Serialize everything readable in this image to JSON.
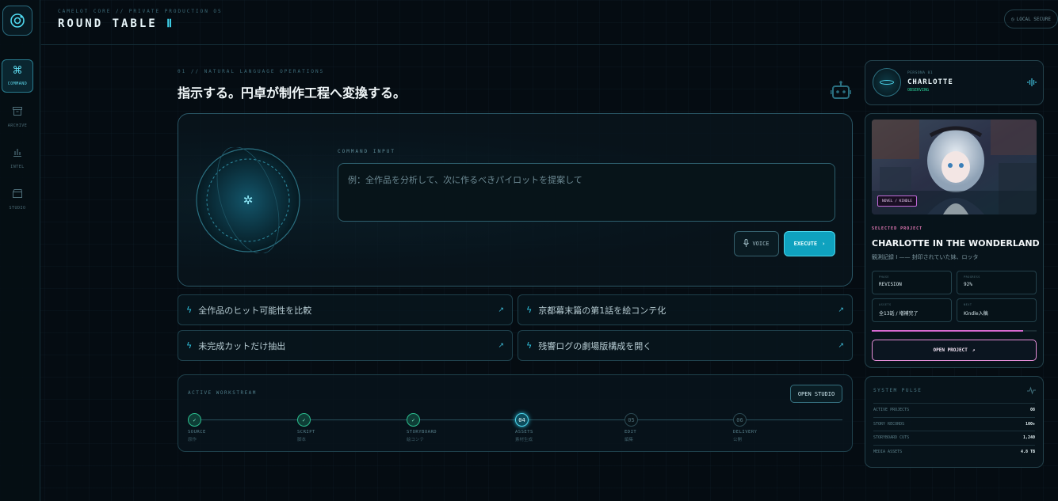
{
  "app": {
    "kicker": "CAMELOT CORE // PRIVATE PRODUCTION OS",
    "title": "ROUND TABLE",
    "title_numeral": "Ⅱ",
    "security_badge": "LOCAL SECURE"
  },
  "sidebar": {
    "items": [
      {
        "label": "COMMAND",
        "icon": "command-icon",
        "active": true
      },
      {
        "label": "ARCHIVE",
        "icon": "archive-icon",
        "active": false
      },
      {
        "label": "INTEL",
        "icon": "chart-icon",
        "active": false
      },
      {
        "label": "STUDIO",
        "icon": "clapperboard-icon",
        "active": false
      }
    ]
  },
  "main": {
    "kicker": "01 // NATURAL LANGUAGE OPERATIONS",
    "heading": "指示する。円卓が制作工程へ変換する。",
    "command": {
      "label": "COMMAND INPUT",
      "placeholder": "例：全作品を分析して、次に作るべきパイロットを提案して",
      "value": "",
      "voice_label": "VOICE",
      "execute_label": "EXECUTE"
    },
    "suggestions": [
      "全作品のヒット可能性を比較",
      "京都幕末篇の第1話を絵コンテ化",
      "未完成カットだけ抽出",
      "残響ログの劇場版構成を開く"
    ],
    "workstream": {
      "label": "ACTIVE WORKSTREAM",
      "open_label": "OPEN STUDIO",
      "steps": [
        {
          "mark": "✓",
          "name": "SOURCE",
          "ja": "原作",
          "state": "done"
        },
        {
          "mark": "✓",
          "name": "SCRIPT",
          "ja": "脚本",
          "state": "done"
        },
        {
          "mark": "✓",
          "name": "STORYBOARD",
          "ja": "絵コンテ",
          "state": "done"
        },
        {
          "mark": "04",
          "name": "ASSETS",
          "ja": "素材生成",
          "state": "current"
        },
        {
          "mark": "05",
          "name": "EDIT",
          "ja": "編集",
          "state": "todo"
        },
        {
          "mark": "06",
          "name": "DELIVERY",
          "ja": "公開",
          "state": "todo"
        }
      ]
    }
  },
  "companion": {
    "subtitle": "PERSONA 01",
    "name": "CHARLOTTE",
    "status": "OBSERVING"
  },
  "project": {
    "tag": "NOVEL / KINDLE",
    "label": "SELECTED PROJECT",
    "title": "CHARLOTTE IN THE WONDERLAND",
    "description": "観測記録 I —— 封印されていた妹、ロッタ",
    "stats": [
      {
        "key": "PHASE",
        "value": "REVISION"
      },
      {
        "key": "PROGRESS",
        "value": "92%"
      },
      {
        "key": "ASSETS",
        "value": "全13話 / 増補完了"
      },
      {
        "key": "NEXT",
        "value": "Kindle入稿"
      }
    ],
    "progress": 0.92,
    "open_label": "OPEN PROJECT"
  },
  "system_pulse": {
    "title": "SYSTEM PULSE",
    "rows": [
      {
        "key": "ACTIVE PROJECTS",
        "value": "08"
      },
      {
        "key": "STORY RECORDS",
        "value": "100+"
      },
      {
        "key": "STORYBOARD CUTS",
        "value": "1,240"
      },
      {
        "key": "MEDIA ASSETS",
        "value": "4.8 TB"
      }
    ]
  },
  "colors": {
    "accent": "#2fc4e0",
    "execute": "#0fa2bf",
    "project_accent": "#d86ad1",
    "done": "#2bbf8f"
  }
}
